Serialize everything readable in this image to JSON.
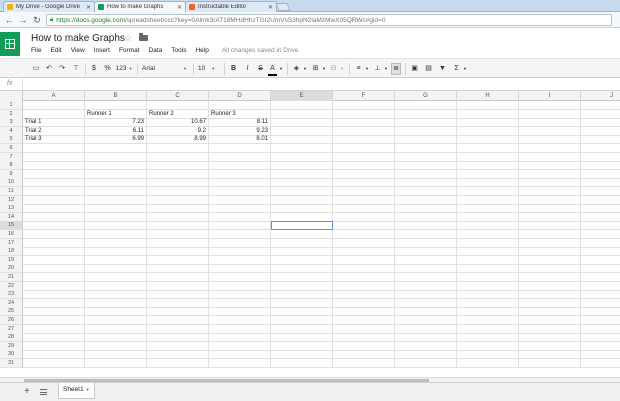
{
  "browser": {
    "tabs": [
      {
        "label": "My Drive - Google Drive",
        "favicon_color": "#f4b400"
      },
      {
        "label": "How to make Graphs",
        "favicon_color": "#0f9d58"
      },
      {
        "label": "Instructable Editor",
        "favicon_color": "#f26522"
      }
    ],
    "url_host": "https://docs.google.com",
    "url_path": "/spreadsheet/ccc?key=0Almk3rAT18MHdHhzTGI2UmVsS3hpN2laMzMwX05QRWc#gid=0"
  },
  "sheets": {
    "title": "How to make Graphs",
    "menus": [
      "File",
      "Edit",
      "View",
      "Insert",
      "Format",
      "Data",
      "Tools",
      "Help"
    ],
    "save_status": "All changes saved in Drive",
    "toolbar": {
      "currency": "$",
      "percent": "%",
      "number_format": "123",
      "font": "Arial",
      "font_size": "10",
      "bold": "B",
      "italic": "I",
      "strike": "S",
      "text_color": "A",
      "sigma": "Σ"
    },
    "fx_label": "fx",
    "columns": [
      "A",
      "B",
      "C",
      "D",
      "E",
      "F",
      "G",
      "H",
      "I",
      "J"
    ],
    "selected_column": "E",
    "selected_row": 15,
    "row_count": 31,
    "cells": {
      "B2": "Runner 1",
      "C2": "Runner 2",
      "D2": "Runner 3",
      "A3": "Trial 1",
      "B3": "7.23",
      "C3": "10.67",
      "D3": "8.11",
      "A4": "Trial 2",
      "B4": "6.11",
      "C4": "9.2",
      "D4": "9.23",
      "A5": "Trial 3",
      "B5": "6.99",
      "C5": "8.99",
      "D5": "8.01"
    },
    "numeric_cells": [
      "B3",
      "C3",
      "D3",
      "B4",
      "C4",
      "D4",
      "B5",
      "C5",
      "D5"
    ],
    "sheet_tab": "Sheet1"
  }
}
